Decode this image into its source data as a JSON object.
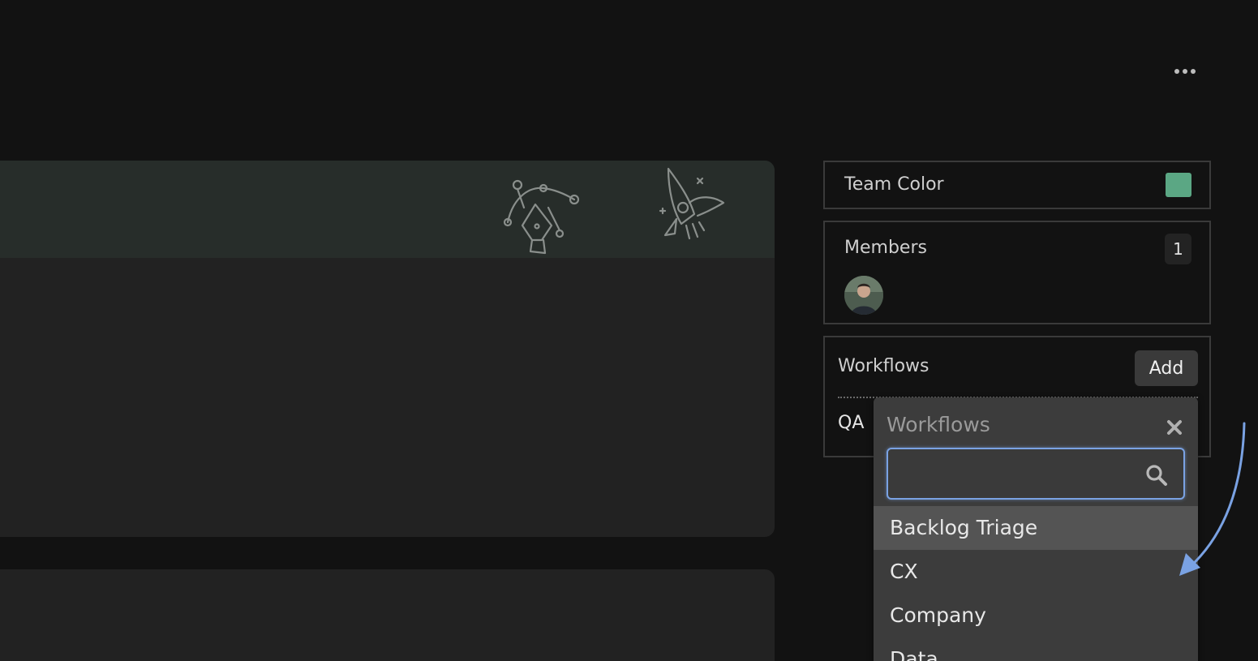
{
  "header": {
    "more_icon": "more-horizontal-icon"
  },
  "banner": {
    "icons": [
      "pen-tool-icon",
      "rocket-icon"
    ]
  },
  "team_color": {
    "label": "Team Color",
    "color": "#5ba784"
  },
  "members": {
    "label": "Members",
    "count": "1"
  },
  "workflows": {
    "label": "Workflows",
    "add_label": "Add",
    "items": [
      "QA"
    ]
  },
  "dropdown": {
    "title": "Workflows",
    "search_value": "",
    "search_placeholder": "",
    "options": [
      "Backlog Triage",
      "CX",
      "Company",
      "Data"
    ],
    "active_index": 0
  },
  "colors": {
    "focus": "#7aa2e3",
    "annotation_arrow": "#7aa2e3"
  }
}
